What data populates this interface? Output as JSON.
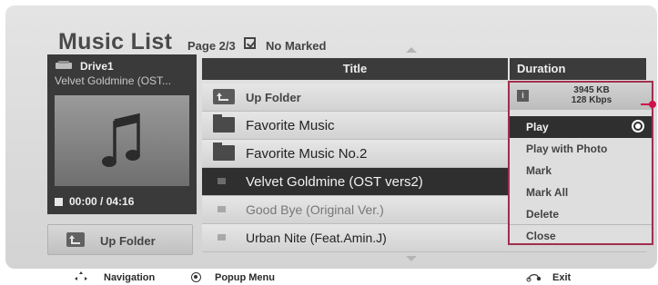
{
  "header": {
    "title": "Music List",
    "page_info": "Page 2/3",
    "mark_status": "No Marked"
  },
  "left_panel": {
    "drive_label": "Drive1",
    "now_playing": "Velvet Goldmine (OST...",
    "time": "00:00 / 04:16",
    "up_folder_button": "Up Folder"
  },
  "list": {
    "columns": {
      "title": "Title",
      "duration": "Duration"
    },
    "rows": [
      {
        "label": "Up Folder",
        "kind": "up-folder"
      },
      {
        "label": "Favorite Music",
        "kind": "folder"
      },
      {
        "label": "Favorite Music No.2",
        "kind": "folder"
      },
      {
        "label": "Velvet Goldmine (OST vers2)",
        "kind": "file",
        "selected": true
      },
      {
        "label": "Good Bye (Original Ver.)",
        "kind": "file"
      },
      {
        "label": "Urban Nite (Feat.Amin.J)",
        "kind": "file"
      }
    ]
  },
  "popup": {
    "file_size": "3945 KB",
    "bitrate": "128 Kbps",
    "items": [
      "Play",
      "Play with Photo",
      "Mark",
      "Mark All",
      "Delete",
      "Close"
    ],
    "selected_item": "Play",
    "border_color": "#a12e4f"
  },
  "footer": {
    "navigation": "Navigation",
    "popup_menu": "Popup Menu",
    "exit": "Exit"
  },
  "icons": {
    "drive": "drive-icon",
    "music_note": "music-note-icon",
    "up_folder": "up-folder-icon",
    "folder": "folder-icon",
    "music_file": "music-file-icon",
    "info": "info-icon",
    "ok_button": "ok-button-icon",
    "navigation": "navigation-arrows-icon",
    "exit": "exit-icon"
  }
}
